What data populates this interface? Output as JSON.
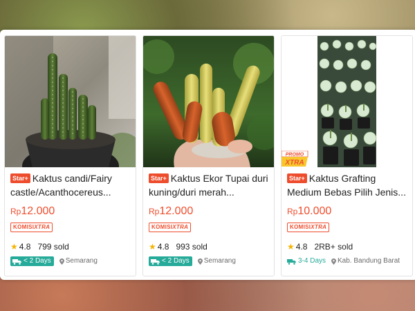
{
  "products": [
    {
      "badge": "Star+",
      "title": "Kaktus candi/Fairy castle/Acanthocereus...",
      "currency": "Rp",
      "price": "12.000",
      "komisi_a": "KOMISI",
      "komisi_b": "XTRA",
      "rating": "4.8",
      "sold": "799 sold",
      "shipping": "< 2 Days",
      "location": "Semarang"
    },
    {
      "badge": "Star+",
      "title": "Kaktus Ekor Tupai duri kuning/duri merah...",
      "currency": "Rp",
      "price": "12.000",
      "komisi_a": "KOMISI",
      "komisi_b": "XTRA",
      "rating": "4.8",
      "sold": "993 sold",
      "shipping": "< 2 Days",
      "location": "Semarang"
    },
    {
      "badge": "Star+",
      "title": "Kaktus Grafting Medium Bebas Pilih Jenis...",
      "currency": "Rp",
      "price": "10.000",
      "komisi_a": "KOMISI",
      "komisi_b": "XTRA",
      "rating": "4.8",
      "sold": "2RB+ sold",
      "shipping": "3-4 Days",
      "location": "Kab. Bandung Barat",
      "promo_line1": "PROMO",
      "promo_line2": "XTRA"
    }
  ],
  "colors": {
    "accent": "#ee4d2d",
    "shipping": "#26aa99",
    "star": "#f5b301"
  }
}
